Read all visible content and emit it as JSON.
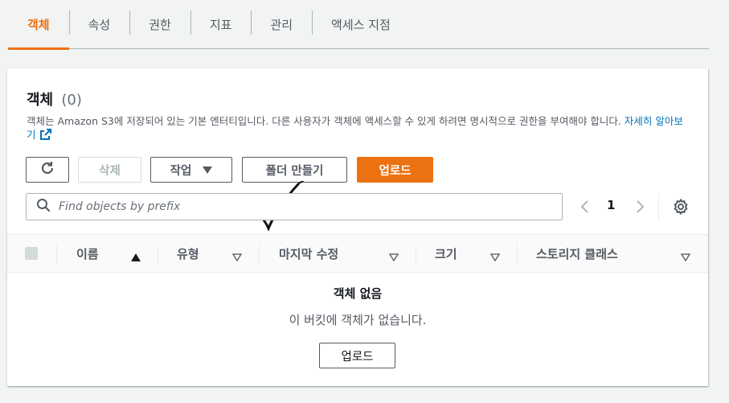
{
  "tabs": [
    {
      "label": "객체",
      "active": true
    },
    {
      "label": "속성",
      "active": false
    },
    {
      "label": "권한",
      "active": false
    },
    {
      "label": "지표",
      "active": false
    },
    {
      "label": "관리",
      "active": false
    },
    {
      "label": "액세스 지점",
      "active": false
    }
  ],
  "panel": {
    "title": "객체",
    "count": "(0)",
    "description": "객체는 Amazon S3에 저장되어 있는 기본 엔터티입니다. 다른 사용자가 객체에 액세스할 수 있게 하려면 명시적으로 권한을 부여해야 합니다.",
    "learn_more": "자세히 알아보기"
  },
  "toolbar": {
    "refresh_icon": "refresh-icon",
    "delete_label": "삭제",
    "actions_label": "작업",
    "create_folder_label": "폴더 만들기",
    "upload_label": "업로드"
  },
  "search": {
    "placeholder": "Find objects by prefix",
    "value": ""
  },
  "pagination": {
    "current_page": "1"
  },
  "table": {
    "columns": [
      "이름",
      "유형",
      "마지막 수정",
      "크기",
      "스토리지 클래스"
    ],
    "sorted_column": "이름",
    "empty_title": "객체 없음",
    "empty_description": "이 버킷에 객체가 없습니다.",
    "empty_upload_label": "업로드"
  },
  "colors": {
    "accent": "#ec7211",
    "link": "#0073bb",
    "text": "#16191f",
    "muted": "#545b64"
  }
}
